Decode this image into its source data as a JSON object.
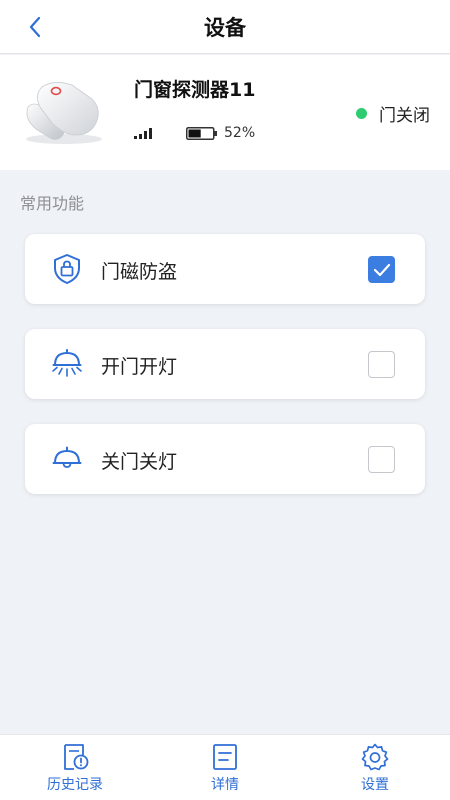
{
  "header": {
    "title": "设备"
  },
  "device": {
    "name": "门窗探测器11",
    "battery": "52%",
    "battery_level": 0.52,
    "signal_icon": "signal-bars-icon",
    "status": "门关闭",
    "status_color": "#2ecc71"
  },
  "section": {
    "title": "常用功能"
  },
  "functions": [
    {
      "label": "门磁防盗",
      "icon": "shield-lock-icon",
      "checked": true
    },
    {
      "label": "开门开灯",
      "icon": "lamp-on-icon",
      "checked": false
    },
    {
      "label": "关门关灯",
      "icon": "lamp-off-icon",
      "checked": false
    }
  ],
  "tabs": [
    {
      "label": "历史记录",
      "icon": "history-icon"
    },
    {
      "label": "详情",
      "icon": "details-icon"
    },
    {
      "label": "设置",
      "icon": "gear-icon"
    }
  ],
  "colors": {
    "accent": "#3b7de0",
    "icon_blue": "#2f6fd6",
    "status_green": "#2ecc71"
  }
}
